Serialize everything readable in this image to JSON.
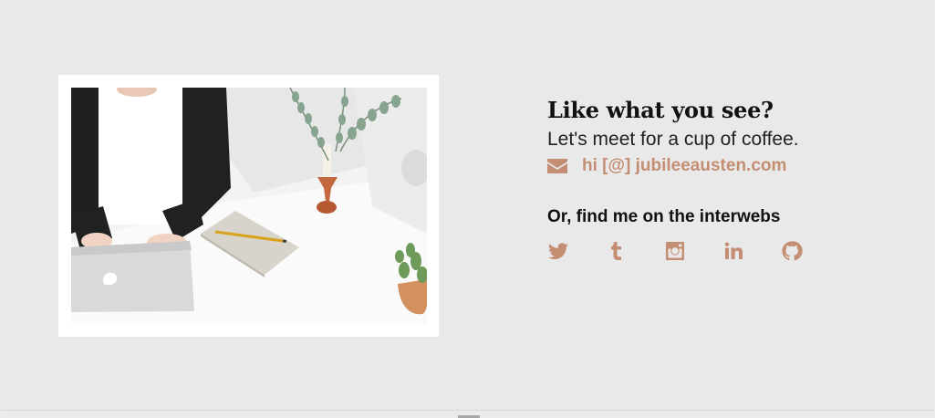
{
  "contact": {
    "headline": "Like what you see?",
    "subhead": "Let's meet for a cup of coffee.",
    "email_text": "hi [@] jubileeausten.com",
    "email_icon": "envelope-icon",
    "find_heading": "Or, find me on the interwebs"
  },
  "social": [
    {
      "icon": "twitter-icon"
    },
    {
      "icon": "tumblr-icon"
    },
    {
      "icon": "instagram-icon"
    },
    {
      "icon": "linkedin-icon"
    },
    {
      "icon": "github-icon"
    }
  ],
  "colors": {
    "background": "#e9e9e9",
    "accent": "#c48e72",
    "heading": "#111111",
    "frame": "#ffffff"
  }
}
